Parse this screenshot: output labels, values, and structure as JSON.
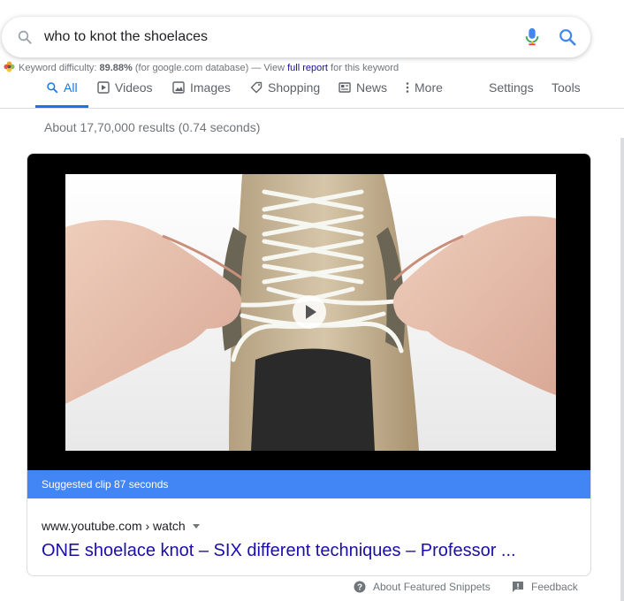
{
  "search": {
    "query": "who to knot the shoelaces",
    "icons": [
      "search-icon",
      "microphone-icon",
      "search-submit-icon"
    ]
  },
  "keyword_difficulty": {
    "label": "Keyword difficulty:",
    "value": "89.88%",
    "scope": "(for google.com database) — View",
    "link": "full report",
    "suffix": "for this keyword"
  },
  "tabs": [
    {
      "label": "All",
      "icon": "search-icon",
      "active": true
    },
    {
      "label": "Videos",
      "icon": "video-play-icon",
      "active": false
    },
    {
      "label": "Images",
      "icon": "image-icon",
      "active": false
    },
    {
      "label": "Shopping",
      "icon": "tag-icon",
      "active": false
    },
    {
      "label": "News",
      "icon": "newspaper-icon",
      "active": false
    },
    {
      "label": "More",
      "icon": "more-vert-icon",
      "active": false
    }
  ],
  "tools": {
    "settings": "Settings",
    "tools": "Tools"
  },
  "result_stats": "About 17,70,000 results (0.74 seconds)",
  "video": {
    "clip_label": "Suggested clip 87 seconds",
    "cite": "www.youtube.com › watch",
    "title": "ONE shoelace knot – SIX different techniques – Professor ..."
  },
  "footer": {
    "about": "About Featured Snippets",
    "feedback": "Feedback"
  },
  "colors": {
    "accent": "#1a73e8",
    "link": "#1a0dab",
    "clip_bar": "#4285f4",
    "muted": "#70757a"
  }
}
